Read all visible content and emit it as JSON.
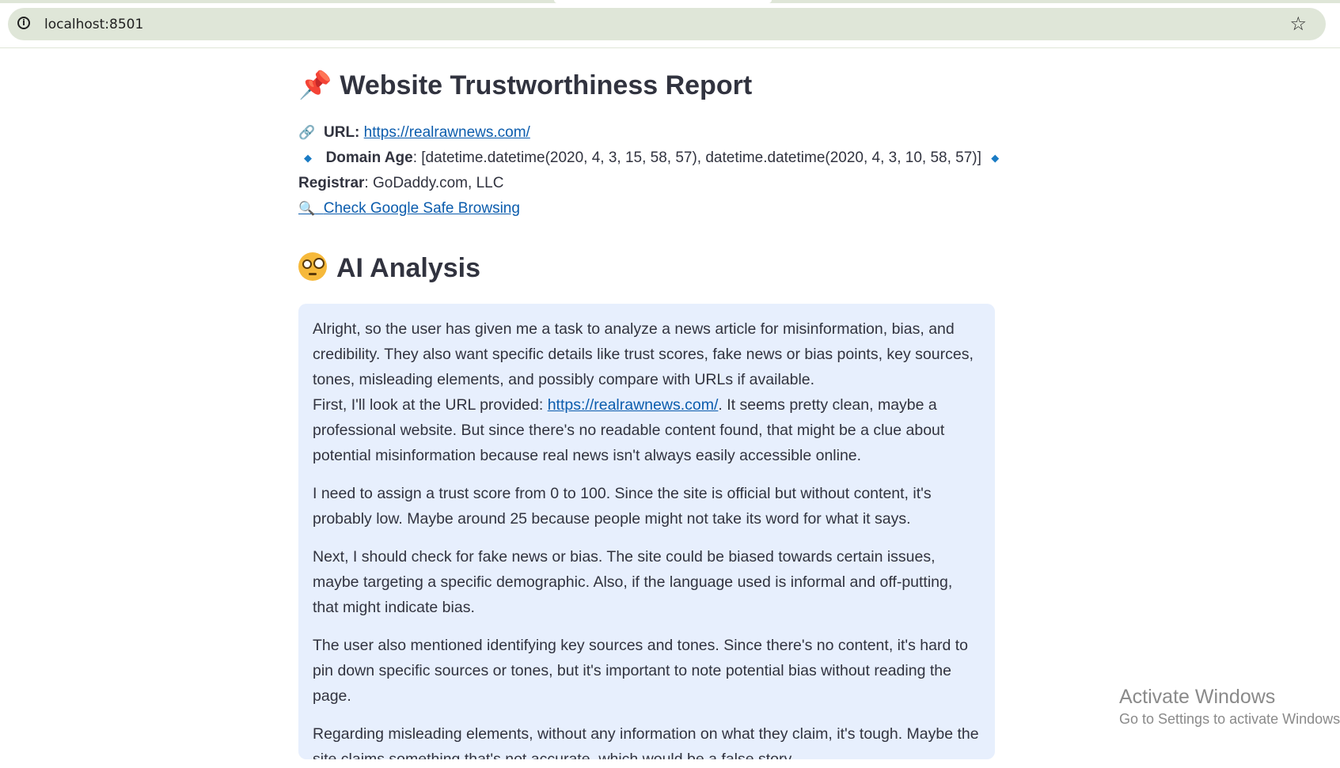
{
  "browser": {
    "address": "localhost:8501",
    "info_icon": "info-icon",
    "bookmark_icon": "star-icon"
  },
  "report": {
    "title_icon": "pushpin-icon",
    "title": "Website Trustworthiness Report",
    "url_icon": "link-icon",
    "url_label": "URL:",
    "url_value": "https://realrawnews.com/",
    "domain_age_label": "Domain Age",
    "domain_age_value": ": [datetime.datetime(2020, 4, 3, 15, 58, 57), datetime.datetime(2020, 4, 3, 10, 58, 57)]",
    "registrar_label": "Registrar",
    "registrar_value": ": GoDaddy.com, LLC",
    "safe_browsing_icon": "magnifier-icon",
    "safe_browsing_link": "Check Google Safe Browsing"
  },
  "analysis": {
    "heading_icon": "face-with-monocle-icon",
    "heading": "AI Analysis",
    "p1_line1": "Alright, so the user has given me a task to analyze a news article for misinformation, bias, and credibility. They also want specific details like trust scores, fake news or bias points, key sources, tones, misleading elements, and possibly compare with URLs if available.",
    "p1_line2_before": "First, I'll look at the URL provided: ",
    "p1_line2_link": "https://realrawnews.com/",
    "p1_line2_after": ". It seems pretty clean, maybe a professional website. But since there's no readable content found, that might be a clue about potential misinformation because real news isn't always easily accessible online.",
    "p2": "I need to assign a trust score from 0 to 100. Since the site is official but without content, it's probably low. Maybe around 25 because people might not take its word for what it says.",
    "p3": "Next, I should check for fake news or bias. The site could be biased towards certain issues, maybe targeting a specific demographic. Also, if the language used is informal and off-putting, that might indicate bias.",
    "p4": "The user also mentioned identifying key sources and tones. Since there's no content, it's hard to pin down specific sources or tones, but it's important to note potential bias without reading the page.",
    "p5": "Regarding misleading elements, without any information on what they claim, it's tough. Maybe the site claims something that's not accurate, which would be a false story."
  },
  "watermark": {
    "line1": "Activate Windows",
    "line2": "Go to Settings to activate Windows."
  }
}
